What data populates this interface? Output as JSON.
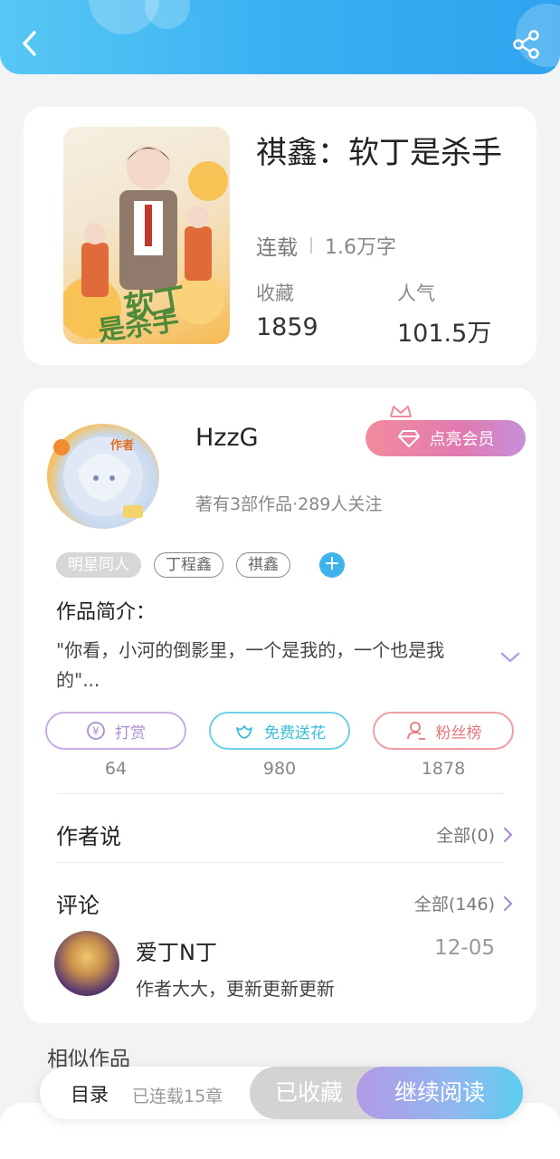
{
  "header": {
    "back_icon": "chevron-left-icon",
    "share_icon": "share-icon"
  },
  "book": {
    "title": "祺鑫：软丁是杀手",
    "status": "连载",
    "word_count": "1.6万字",
    "favorites_label": "收藏",
    "favorites_value": "1859",
    "popularity_label": "人气",
    "popularity_value": "101.5万"
  },
  "author": {
    "name": "HzzG",
    "info": "著有3部作品·289人关注",
    "member_button": "点亮会员",
    "tags": [
      "明星同人",
      "丁程鑫",
      "祺鑫"
    ],
    "intro_title": "作品简介：",
    "intro_text": "\"你看，小河的倒影里，一个是我的，一个也是我的\"..."
  },
  "actions": [
    {
      "label": "打赏",
      "count": "64",
      "icon": "yuan-coin-icon"
    },
    {
      "label": "免费送花",
      "count": "980",
      "icon": "flower-icon"
    },
    {
      "label": "粉丝榜",
      "count": "1878",
      "icon": "fan-ranking-icon"
    }
  ],
  "author_says": {
    "title": "作者说",
    "more": "全部(0)"
  },
  "comments": {
    "title": "评论",
    "more": "全部(146)",
    "items": [
      {
        "user": "爱丁N丁",
        "date": "12-05",
        "text": "作者大大，更新更新更新"
      }
    ]
  },
  "similar": {
    "title": "相似作品"
  },
  "bottom_bar": {
    "toc_label": "目录",
    "toc_status": "已连载15章",
    "collected_label": "已收藏",
    "read_label": "继续阅读"
  },
  "colors": {
    "header_start": "#57c8f4",
    "header_end": "#2fa3ee",
    "accent_blue": "#3fb4ec",
    "member_pink": "#f38b9c",
    "read_purple": "#b39ae6"
  }
}
